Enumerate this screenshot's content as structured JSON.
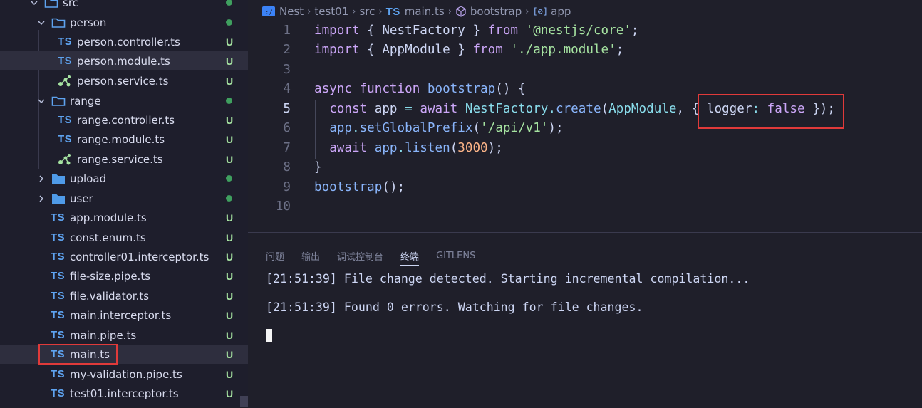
{
  "explorer": {
    "items": [
      {
        "label": "src",
        "type": "folder",
        "status": "dot"
      },
      {
        "label": "person",
        "type": "folder",
        "status": "dot"
      },
      {
        "label": "person.controller.ts",
        "type": "ts",
        "status": "U"
      },
      {
        "label": "person.module.ts",
        "type": "ts",
        "status": "U"
      },
      {
        "label": "person.service.ts",
        "type": "service",
        "status": "U"
      },
      {
        "label": "range",
        "type": "folder",
        "status": "dot"
      },
      {
        "label": "range.controller.ts",
        "type": "ts",
        "status": "U"
      },
      {
        "label": "range.module.ts",
        "type": "ts",
        "status": "U"
      },
      {
        "label": "range.service.ts",
        "type": "service",
        "status": "U"
      },
      {
        "label": "upload",
        "type": "folder",
        "status": "dot"
      },
      {
        "label": "user",
        "type": "folder",
        "status": "dot"
      },
      {
        "label": "app.module.ts",
        "type": "ts",
        "status": "U"
      },
      {
        "label": "const.enum.ts",
        "type": "ts",
        "status": "U"
      },
      {
        "label": "controller01.interceptor.ts",
        "type": "ts",
        "status": "U"
      },
      {
        "label": "file-size.pipe.ts",
        "type": "ts",
        "status": "U"
      },
      {
        "label": "file.validator.ts",
        "type": "ts",
        "status": "U"
      },
      {
        "label": "main.interceptor.ts",
        "type": "ts",
        "status": "U"
      },
      {
        "label": "main.pipe.ts",
        "type": "ts",
        "status": "U"
      },
      {
        "label": "main.ts",
        "type": "ts",
        "status": "U"
      },
      {
        "label": "my-validation.pipe.ts",
        "type": "ts",
        "status": "U"
      },
      {
        "label": "test01.interceptor.ts",
        "type": "ts",
        "status": "U"
      }
    ],
    "ts_badge": "TS",
    "status_untracked": "U"
  },
  "breadcrumb": {
    "items": [
      "Nest",
      "test01",
      "src",
      "main.ts",
      "bootstrap",
      "app"
    ],
    "file_badge": "TS"
  },
  "editor": {
    "line_numbers": [
      "1",
      "2",
      "3",
      "4",
      "5",
      "6",
      "7",
      "8",
      "9",
      "10"
    ],
    "active_line": "5",
    "lines": [
      "import { NestFactory } from '@nestjs/core';",
      "import { AppModule } from './app.module';",
      "",
      "async function bootstrap() {",
      "  const app = await NestFactory.create(AppModule, { logger: false });",
      "  app.setGlobalPrefix('/api/v1');",
      "  await app.listen(3000);",
      "}",
      "bootstrap();",
      ""
    ]
  },
  "panel": {
    "tabs": [
      "问题",
      "输出",
      "调试控制台",
      "终端",
      "GITLENS"
    ],
    "active_tab": "终端",
    "terminal_lines": [
      "[21:51:39] File change detected. Starting incremental compilation...",
      "[21:51:39] Found 0 errors. Watching for file changes."
    ]
  },
  "colors": {
    "keyword": "#cba6f7",
    "function": "#89b4fa",
    "string": "#a6e3a1",
    "number": "#fab387",
    "highlight_box": "#e03a3a"
  }
}
